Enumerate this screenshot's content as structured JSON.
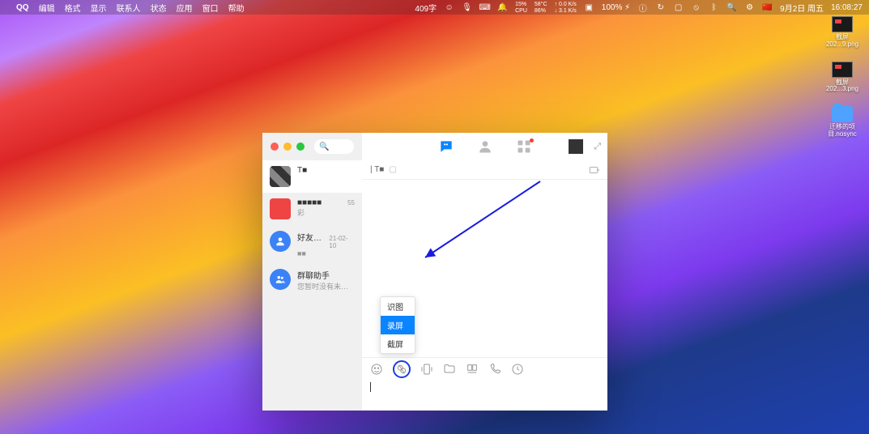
{
  "menubar": {
    "app_name": "QQ",
    "items": [
      "编辑",
      "格式",
      "显示",
      "联系人",
      "状态",
      "应用",
      "窗口",
      "帮助"
    ],
    "ime": "409字",
    "cpu": {
      "pct": "15%",
      "label": "CPU"
    },
    "temp": {
      "val": "58°C",
      "label": "86%"
    },
    "net": {
      "up": "↑ 0.0 K/s",
      "down": "↓ 3.1 K/s"
    },
    "battery": "100% ⚡︎",
    "date": "9月2日 周五",
    "time": "16:08:27"
  },
  "desktop": {
    "files": [
      {
        "name": "截屏",
        "sub": "202...9.png",
        "kind": "img"
      },
      {
        "name": "截屏",
        "sub": "202...3.png",
        "kind": "img"
      },
      {
        "name": "迁移的项",
        "sub": "目.nosync",
        "kind": "folder"
      }
    ]
  },
  "qq": {
    "search_placeholder": "🔍",
    "chats": [
      {
        "name": "T■",
        "time": "",
        "preview": "",
        "avatar": "pix",
        "active": true
      },
      {
        "name": "■■■■■",
        "time": "55",
        "preview": "彩",
        "avatar": "red"
      },
      {
        "name": "好友验…",
        "time": "21-02-10",
        "preview": "■■",
        "avatar": "blue_user"
      },
      {
        "name": "群聊助手",
        "time": "",
        "preview": "您暂时没有未读消息",
        "avatar": "blue_group"
      }
    ],
    "chat_header_name": "|  T■",
    "popup": {
      "items": [
        "识图",
        "录屏",
        "截屏"
      ],
      "selected_index": 1
    }
  }
}
